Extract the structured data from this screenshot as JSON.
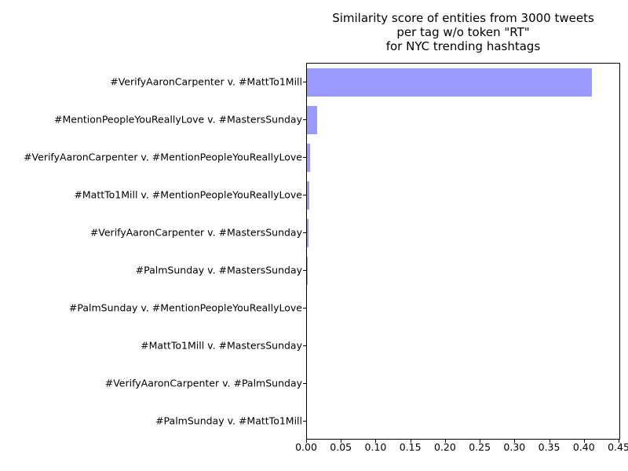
{
  "chart_data": {
    "type": "bar",
    "orientation": "horizontal",
    "title_lines": [
      "Similarity score of entities from 3000 tweets",
      "per tag w/o token \"RT\"",
      "for NYC trending hashtags"
    ],
    "categories": [
      "#VerifyAaronCarpenter v. #MattTo1Mill",
      "#MentionPeopleYouReallyLove v. #MastersSunday",
      "#VerifyAaronCarpenter v. #MentionPeopleYouReallyLove",
      "#MattTo1Mill v. #MentionPeopleYouReallyLove",
      "#VerifyAaronCarpenter v. #MastersSunday",
      "#PalmSunday v. #MastersSunday",
      "#PalmSunday v. #MentionPeopleYouReallyLove",
      "#MattTo1Mill v. #MastersSunday",
      "#VerifyAaronCarpenter v. #PalmSunday",
      "#PalmSunday v. #MattTo1Mill"
    ],
    "values": [
      0.41,
      0.015,
      0.004,
      0.003,
      0.002,
      0.001,
      0.0,
      0.0,
      0.0,
      0.0
    ],
    "xlim": [
      0.0,
      0.45
    ],
    "xticks": [
      0.0,
      0.05,
      0.1,
      0.15,
      0.2,
      0.25,
      0.3,
      0.35,
      0.4,
      0.45
    ],
    "xtick_labels": [
      "0.00",
      "0.05",
      "0.10",
      "0.15",
      "0.20",
      "0.25",
      "0.30",
      "0.35",
      "0.40",
      "0.45"
    ],
    "bar_color": "#9999ff"
  }
}
